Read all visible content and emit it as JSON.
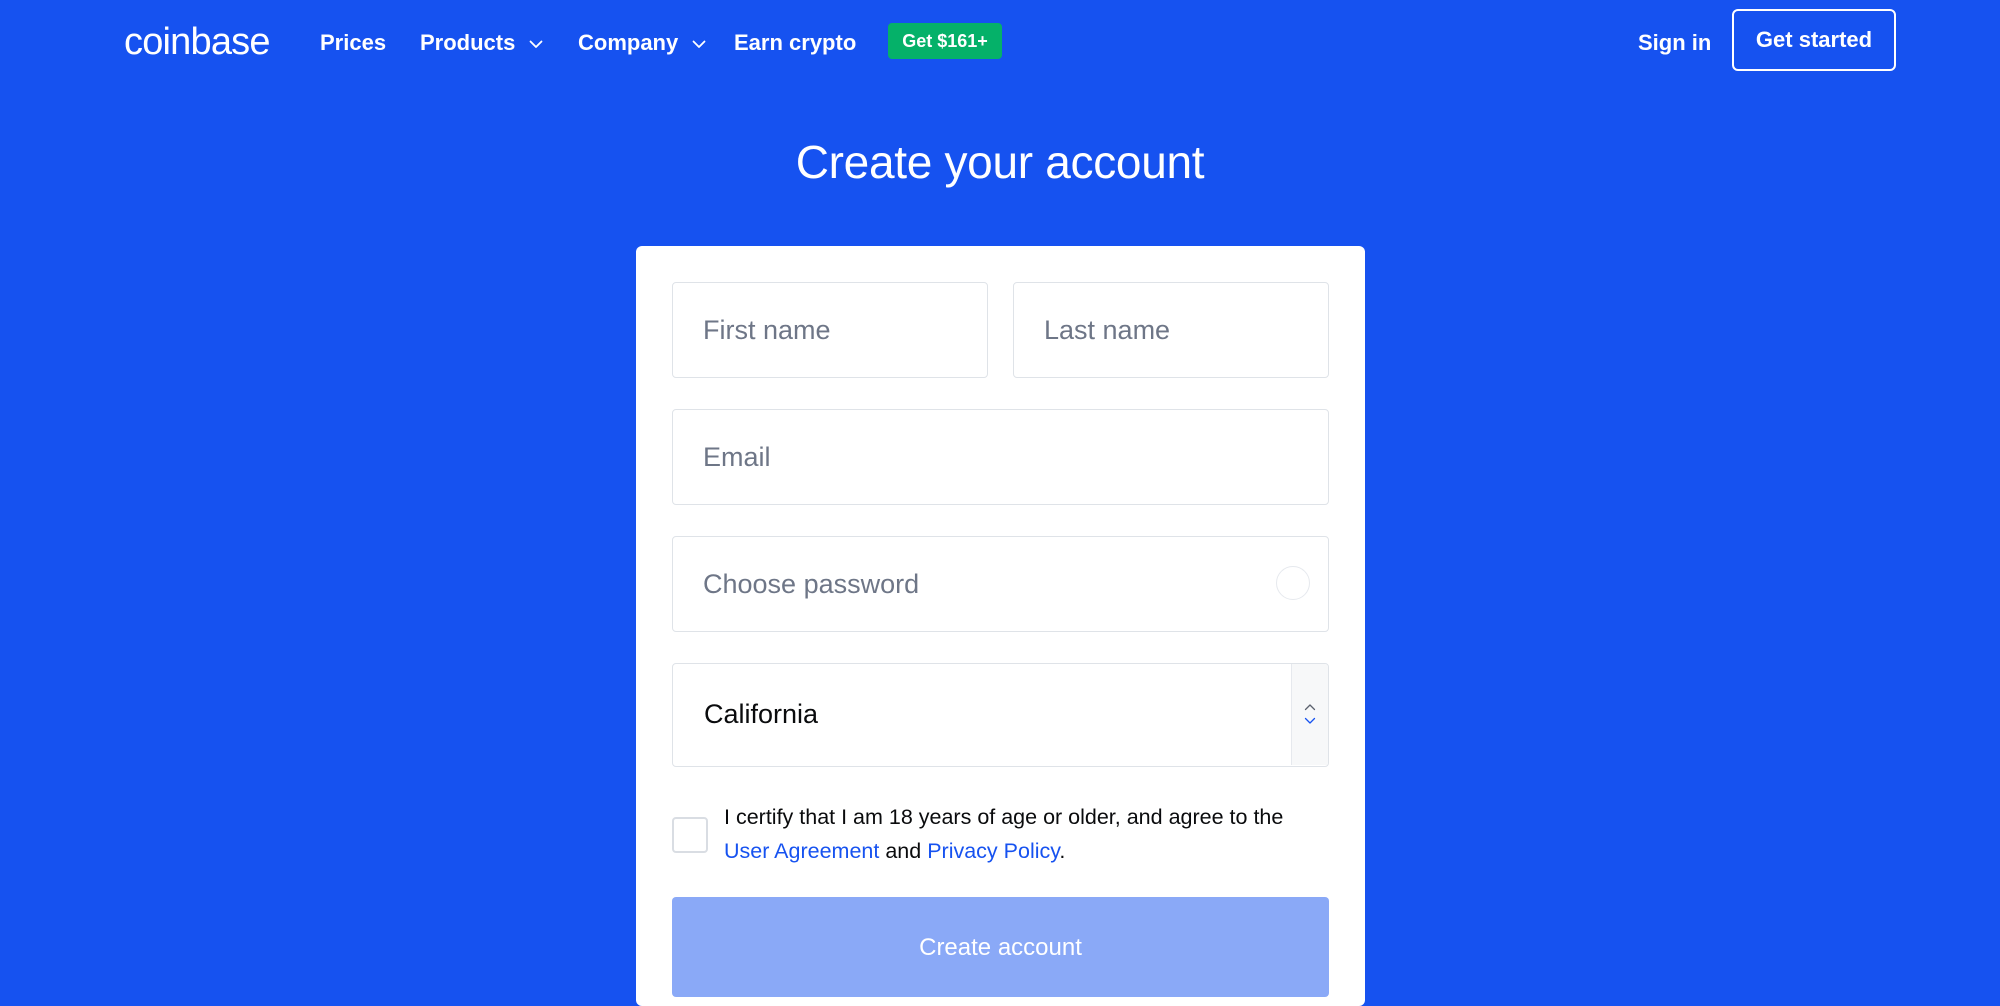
{
  "brand": {
    "logo_text": "coinbase"
  },
  "nav": {
    "items": [
      {
        "label": "Prices"
      },
      {
        "label": "Products",
        "icon": "chevron-down-icon"
      },
      {
        "label": "Company",
        "icon": "chevron-down-icon"
      },
      {
        "label": "Earn crypto"
      }
    ],
    "promo_badge": "Get $161+",
    "sign_in": "Sign in",
    "get_started": "Get started"
  },
  "page": {
    "title": "Create your account"
  },
  "form": {
    "first_name": {
      "placeholder": "First name",
      "value": ""
    },
    "last_name": {
      "placeholder": "Last name",
      "value": ""
    },
    "email": {
      "placeholder": "Email",
      "value": ""
    },
    "password": {
      "placeholder": "Choose password",
      "value": ""
    },
    "state": {
      "selected": "California"
    },
    "consent": {
      "checked": false,
      "text_before": "I certify that I am 18 years of age or older, and agree to the ",
      "user_agreement": "User Agreement",
      "joiner": " and ",
      "privacy_policy": "Privacy Policy",
      "text_after": "."
    },
    "submit_label": "Create account"
  },
  "colors": {
    "background": "#1652f0",
    "badge": "#05b169",
    "button_disabled": "#8aa9f7",
    "link": "#1652f0"
  }
}
